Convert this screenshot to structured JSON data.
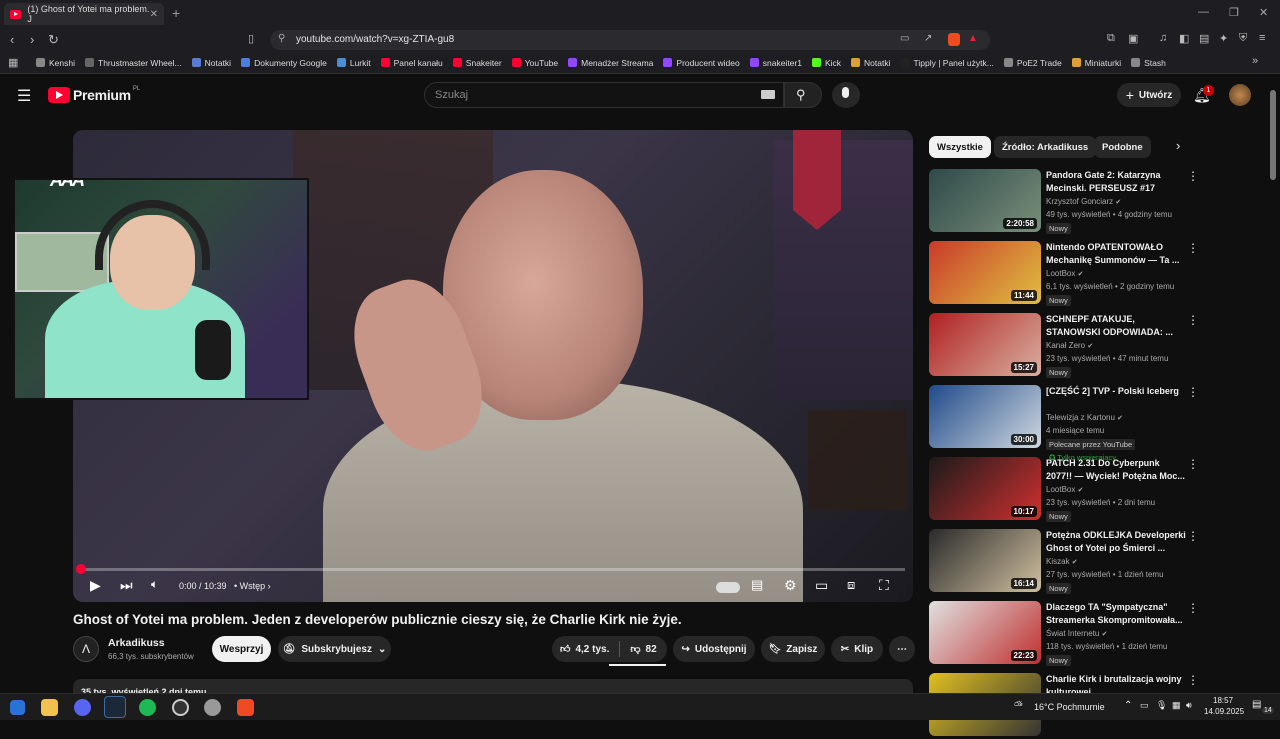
{
  "browser": {
    "tab_title": "(1) Ghost of Yotei ma problem. J",
    "url": "youtube.com/watch?v=xg-ZTIA-gu8",
    "bookmarks": [
      {
        "label": "Kenshi",
        "color": "#888888"
      },
      {
        "label": "Thrustmaster Wheel...",
        "color": "#666666"
      },
      {
        "label": "Notatki",
        "color": "#5b7bd5"
      },
      {
        "label": "Dokumenty Google",
        "color": "#4a7ee0"
      },
      {
        "label": "Lurkit",
        "color": "#4a8fd6"
      },
      {
        "label": "Panel kanału",
        "color": "#ff0033"
      },
      {
        "label": "Snakeiter",
        "color": "#ff0033"
      },
      {
        "label": "YouTube",
        "color": "#ff0033"
      },
      {
        "label": "Menadżer Streama",
        "color": "#9146ff"
      },
      {
        "label": "Producent wideo",
        "color": "#9146ff"
      },
      {
        "label": "snakeiter1",
        "color": "#9146ff"
      },
      {
        "label": "Kick",
        "color": "#53fc18"
      },
      {
        "label": "Notatki",
        "color": "#e0a030"
      },
      {
        "label": "Tipply | Panel użytk...",
        "color": "#222222"
      },
      {
        "label": "PoE2 Trade",
        "color": "#888888"
      },
      {
        "label": "Miniaturki",
        "color": "#e0a030"
      },
      {
        "label": "Stash",
        "color": "#888888"
      }
    ]
  },
  "youtube": {
    "logo_text": "Premium",
    "logo_region": "PL",
    "search_placeholder": "Szukaj",
    "create_label": "Utwórz",
    "notif_count": "1"
  },
  "player": {
    "time": "0:00 / 10:39",
    "chapter": "• Wstęp",
    "progress": 0.0,
    "webcam_logo": "AAA"
  },
  "video": {
    "title": "Ghost of Yotei ma problem. Jeden z developerów publicznie cieszy się, że Charlie Kirk nie żyje.",
    "channel": "Arkadikuss",
    "subscribers": "66,3 tys. subskrybentów",
    "support_label": "Wesprzyj",
    "subscribed_label": "Subskrybujesz",
    "likes": "4,2 tys.",
    "dislikes": "82",
    "share_label": "Udostępnij",
    "save_label": "Zapisz",
    "clip_label": "Klip",
    "views_line": "35 tys. wyświetleń  2 dni temu"
  },
  "chips": [
    "Wszystkie",
    "Źródło: Arkadikuss",
    "Podobne"
  ],
  "recommendations": [
    {
      "title": "Pandora Gate 2: Katarzyna Mecinski. PERSEUSZ #17",
      "channel": "Krzysztof Gonciarz",
      "meta": "49 tys. wyświetleń • 4 godziny temu",
      "badge": "Nowy",
      "duration": "2:20:58",
      "thumb": [
        "#2e4a4a",
        "#7a8f7a"
      ]
    },
    {
      "title": "Nintendo OPATENTOWAŁO Mechanikę Summonów — Ta ...",
      "channel": "LootBox",
      "meta": "6,1 tys. wyświetleń • 2 godziny temu",
      "badge": "Nowy",
      "duration": "11:44",
      "thumb": [
        "#c93a2a",
        "#e0c040"
      ]
    },
    {
      "title": "SCHNEPF ATAKUJE, STANOWSKI ODPOWIADA: ...",
      "channel": "Kanał Zero",
      "meta": "23 tys. wyświetleń • 47 minut temu",
      "badge": "Nowy",
      "duration": "15:27",
      "thumb": [
        "#b02020",
        "#d9b0a0"
      ]
    },
    {
      "title": "[CZĘŚĆ 2] TVP - Polski Iceberg",
      "channel": "Telewizja z Kartonu",
      "meta": "4 miesiące temu",
      "badge": "Polecane przez YouTube",
      "extra": "Tylko wspierający",
      "duration": "30:00",
      "thumb": [
        "#1f4a8a",
        "#d0d8e0"
      ]
    },
    {
      "title": "PATCH 2.31 Do Cyberpunk 2077!! — Wyciek! Potężna Moc...",
      "channel": "LootBox",
      "meta": "23 tys. wyświetleń • 2 dni temu",
      "badge": "Nowy",
      "duration": "10:17",
      "thumb": [
        "#1a1a1a",
        "#d03030"
      ]
    },
    {
      "title": "Potężna ODKLEJKA Developerki Ghost of Yotei po Śmierci ...",
      "channel": "Kiszak",
      "meta": "27 tys. wyświetleń • 1 dzień temu",
      "badge": "Nowy",
      "duration": "16:14",
      "thumb": [
        "#2a2a2a",
        "#d0c0a0"
      ]
    },
    {
      "title": "Dlaczego TA \"Sympatyczna\" Streamerka Skompromitowała...",
      "channel": "Świat Internetu",
      "meta": "118 tys. wyświetleń • 1 dzień temu",
      "badge": "Nowy",
      "duration": "22:23",
      "thumb": [
        "#e0e0e0",
        "#c03030"
      ]
    },
    {
      "title": "Charlie Kirk i brutalizacja wojny kulturowej",
      "channel": "",
      "meta": "",
      "badge": "",
      "duration": "",
      "thumb": [
        "#e0c020",
        "#333333"
      ]
    }
  ],
  "taskbar": {
    "weather": "16°C  Pochmurnie",
    "time": "18:57",
    "date": "14.09.2025",
    "notif": "14"
  },
  "colors": {
    "accent": "#ff0033",
    "bg": "#0f0f0f"
  }
}
